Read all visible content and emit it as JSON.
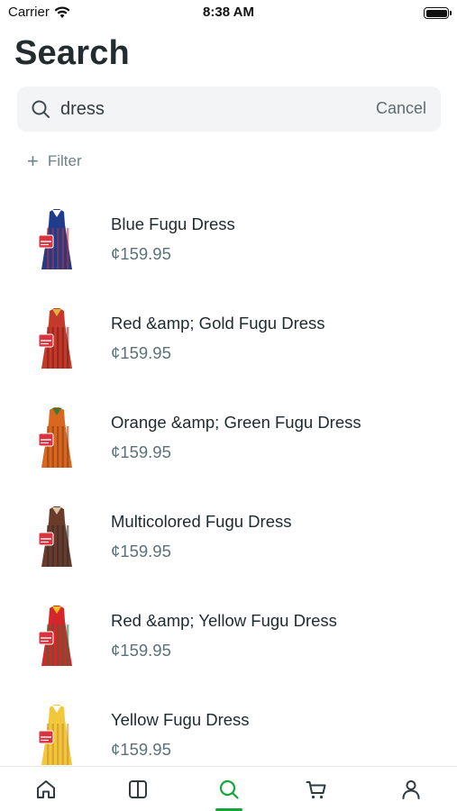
{
  "status_bar": {
    "carrier": "Carrier",
    "time": "8:38 AM"
  },
  "header": {
    "title": "Search"
  },
  "search": {
    "value": "dress",
    "placeholder": "",
    "cancel_label": "Cancel"
  },
  "filter": {
    "label": "Filter",
    "icon": "plus-icon"
  },
  "products": [
    {
      "name": "Blue Fugu Dress",
      "price": "¢159.95",
      "colors": [
        "#1f3c8a",
        "#ffffff",
        "#c8302c"
      ]
    },
    {
      "name": "Red &amp; Gold Fugu Dress",
      "price": "¢159.95",
      "colors": [
        "#c43a2a",
        "#e3b23c",
        "#7a1a14"
      ]
    },
    {
      "name": "Orange &amp; Green Fugu Dress",
      "price": "¢159.95",
      "colors": [
        "#d8671f",
        "#3c7a34",
        "#8a3a16"
      ]
    },
    {
      "name": "Multicolored Fugu Dress",
      "price": "¢159.95",
      "colors": [
        "#6a3b2a",
        "#d9c6a8",
        "#2b2b2b"
      ]
    },
    {
      "name": "Red &amp; Yellow Fugu Dress",
      "price": "¢159.95",
      "colors": [
        "#d4262b",
        "#f0c21a",
        "#1a7a3a"
      ]
    },
    {
      "name": "Yellow Fugu Dress",
      "price": "¢159.95",
      "colors": [
        "#f2c73a",
        "#ffffff",
        "#c98a2a"
      ]
    }
  ],
  "tab_bar": {
    "tabs": [
      {
        "name": "home",
        "icon": "home-icon"
      },
      {
        "name": "catalog",
        "icon": "catalog-icon"
      },
      {
        "name": "search",
        "icon": "search-icon",
        "active": true
      },
      {
        "name": "cart",
        "icon": "cart-icon"
      },
      {
        "name": "account",
        "icon": "user-icon"
      }
    ],
    "active_color": "#15a63a",
    "inactive_color": "#2f3b40"
  }
}
